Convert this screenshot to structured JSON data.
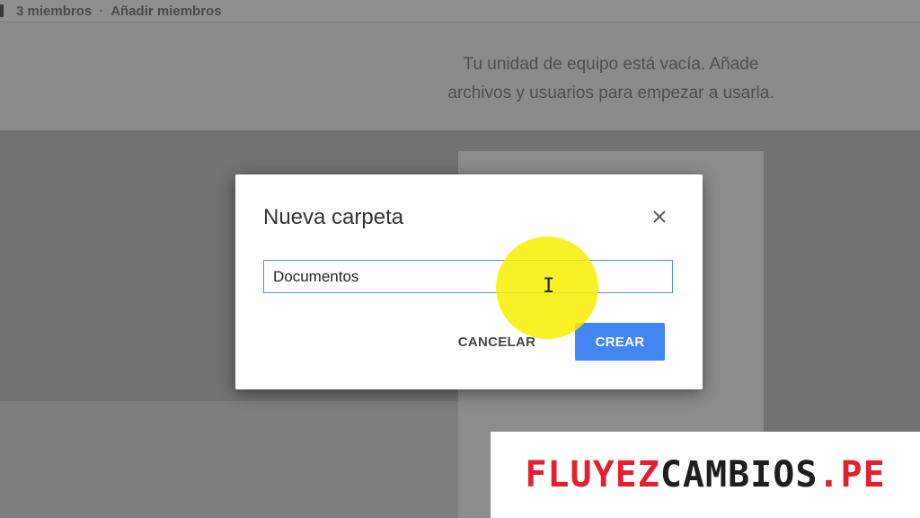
{
  "header": {
    "members_count": "3 miembros",
    "separator": "·",
    "add_members": "Añadir miembros"
  },
  "empty_state": {
    "line1": "Tu unidad de equipo está vacía. Añade",
    "line2": "archivos y usuarios para empezar a usarla."
  },
  "dialog": {
    "title": "Nueva carpeta",
    "close_icon": "close-icon",
    "input_value": "Documentos",
    "cancel_label": "CANCELAR",
    "create_label": "CREAR",
    "accent_color": "#4285f4"
  },
  "cursor": {
    "glyph": "I",
    "highlight_color": "#f6ee00"
  },
  "watermark": {
    "part1": "FLUYEZ",
    "part2": "CAMBIOS",
    "part3": ".PE"
  }
}
